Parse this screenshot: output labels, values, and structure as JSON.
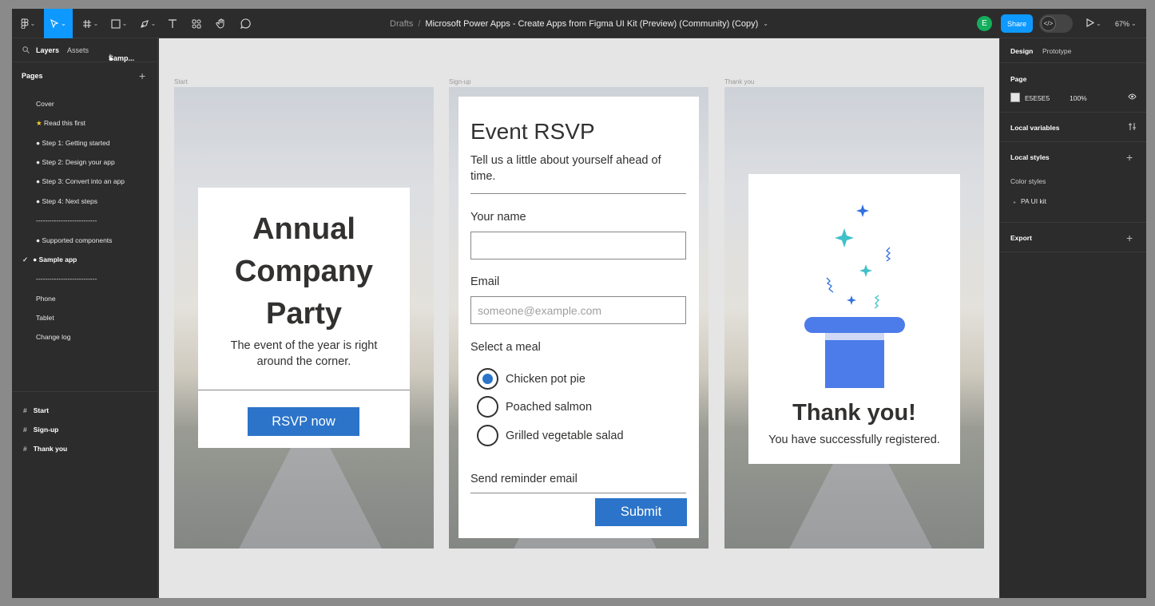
{
  "toolbar": {
    "breadcrumb_root": "Drafts",
    "breadcrumb_sep": "/",
    "file_name": "Microsoft Power Apps - Create Apps from Figma UI Kit (Preview) (Community) (Copy)",
    "avatar_initial": "E",
    "share_label": "Share",
    "devmode_label": "</>",
    "zoom": "67%"
  },
  "left_panel": {
    "tabs": [
      "Layers",
      "Assets"
    ],
    "current_page": "Samp...",
    "pages_header": "Pages",
    "pages": [
      "Cover",
      "Read this first",
      "Step 1: Getting started",
      "Step 2: Design your app",
      "Step 3: Convert into an app",
      "Step 4: Next steps",
      "---------------------------",
      "Supported components",
      "Sample app",
      "---------------------------",
      "Phone",
      "Tablet",
      "Change log"
    ],
    "frames": [
      "Start",
      "Sign-up",
      "Thank you"
    ]
  },
  "canvas": {
    "frame_labels": [
      "Start",
      "Sign-up",
      "Thank you"
    ],
    "start": {
      "title": "Annual Company Party",
      "description": "The event of the year is right around the corner.",
      "button": "RSVP now"
    },
    "signup": {
      "title": "Event RSVP",
      "subtitle": "Tell us a little about yourself ahead of time.",
      "name_label": "Your name",
      "name_value": "",
      "email_label": "Email",
      "email_placeholder": "someone@example.com",
      "meal_label": "Select a meal",
      "meals": [
        "Chicken pot pie",
        "Poached salmon",
        "Grilled vegetable salad"
      ],
      "selected_meal_index": 0,
      "reminder_label": "Send reminder email",
      "submit": "Submit"
    },
    "thankyou": {
      "title": "Thank you!",
      "subtitle": "You have successfully registered."
    },
    "help": "?"
  },
  "right_panel": {
    "tabs": [
      "Design",
      "Prototype"
    ],
    "page_header": "Page",
    "page_color": "E5E5E5",
    "page_opacity": "100%",
    "local_variables": "Local variables",
    "local_styles": "Local styles",
    "color_styles": "Color styles",
    "color_style_item": "PA UI kit",
    "export": "Export"
  },
  "colors": {
    "accent": "#0d99ff",
    "button_blue": "#2b74c9",
    "canvas_bg": "#e5e5e5",
    "panel_bg": "#2c2c2c"
  }
}
